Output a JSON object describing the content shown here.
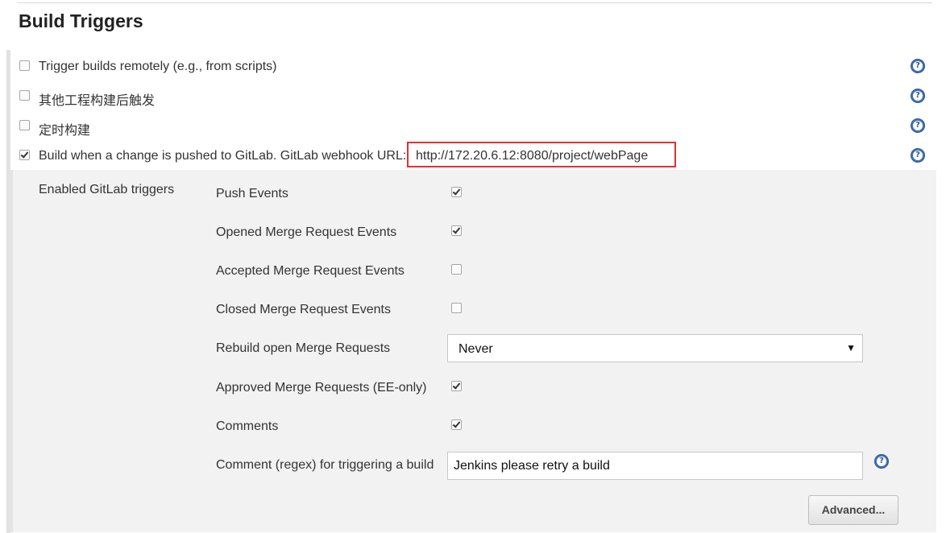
{
  "section_title": "Build Triggers",
  "triggers": [
    {
      "label": "Trigger builds remotely (e.g., from scripts)",
      "checked": false
    },
    {
      "label": "其他工程构建后触发",
      "checked": false
    },
    {
      "label": "定时构建",
      "checked": false
    },
    {
      "label": "Build when a change is pushed to GitLab. GitLab webhook URL:",
      "checked": true
    }
  ],
  "webhook_url": "http://172.20.6.12:8080/project/webPage",
  "gitlab": {
    "enabled_triggers_label": "Enabled GitLab triggers",
    "push_events": {
      "label": "Push Events",
      "checked": true
    },
    "opened_mr_events": {
      "label": "Opened Merge Request Events",
      "checked": true
    },
    "accepted_mr_events": {
      "label": "Accepted Merge Request Events",
      "checked": false
    },
    "closed_mr_events": {
      "label": "Closed Merge Request Events",
      "checked": false
    },
    "rebuild_open_mr": {
      "label": "Rebuild open Merge Requests",
      "selected": "Never"
    },
    "approved_mr": {
      "label": "Approved Merge Requests (EE-only)",
      "checked": true
    },
    "comments": {
      "label": "Comments",
      "checked": true
    },
    "comment_regex": {
      "label": "Comment (regex) for triggering a build",
      "value": "Jenkins please retry a build"
    },
    "advanced_button": "Advanced..."
  },
  "colors": {
    "highlight": "#e03131",
    "help_icon": "#4472b3",
    "panel": "#f2f2f2"
  }
}
